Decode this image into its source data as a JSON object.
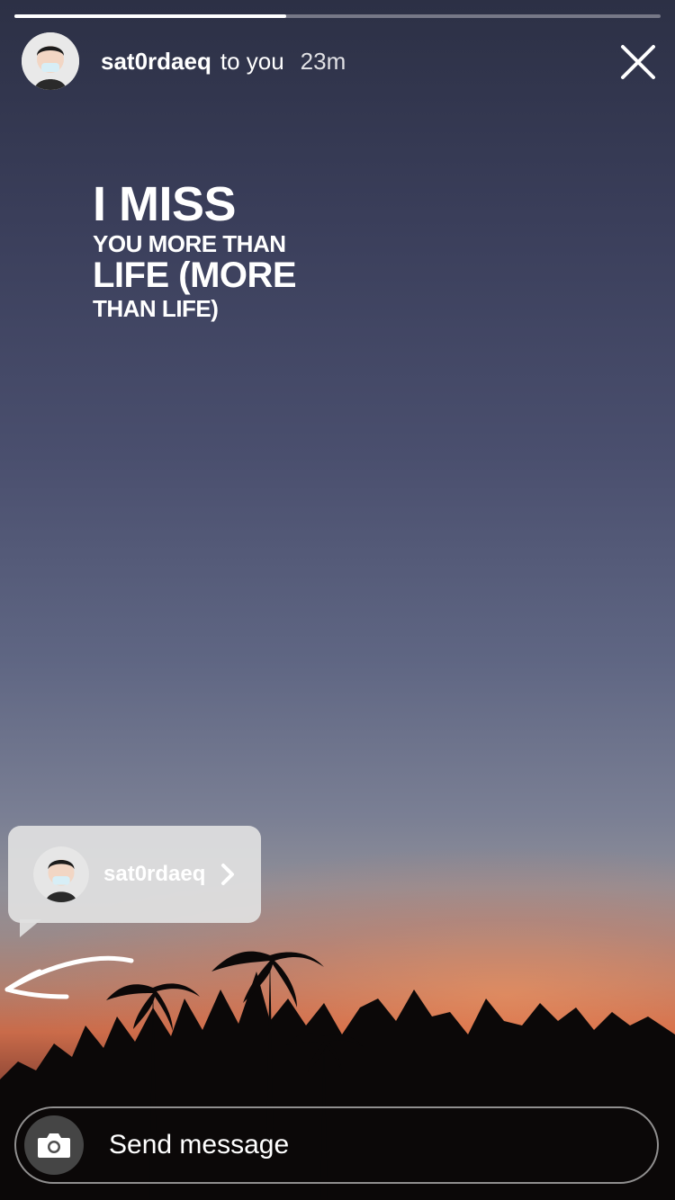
{
  "story": {
    "progress": 0.42,
    "username": "sat0rdaeq",
    "to_you": "to you",
    "time": "23m",
    "caption": [
      "I MISS",
      "YOU MORE THAN",
      "LIFE (MORE",
      "THAN LIFE)"
    ]
  },
  "mention": {
    "username": "sat0rdaeq"
  },
  "composer": {
    "placeholder": "Send message"
  },
  "icons": {
    "close": "close-icon",
    "camera": "camera-icon",
    "chevron": "chevron-right-icon",
    "arrow": "hand-drawn-arrow-icon"
  }
}
